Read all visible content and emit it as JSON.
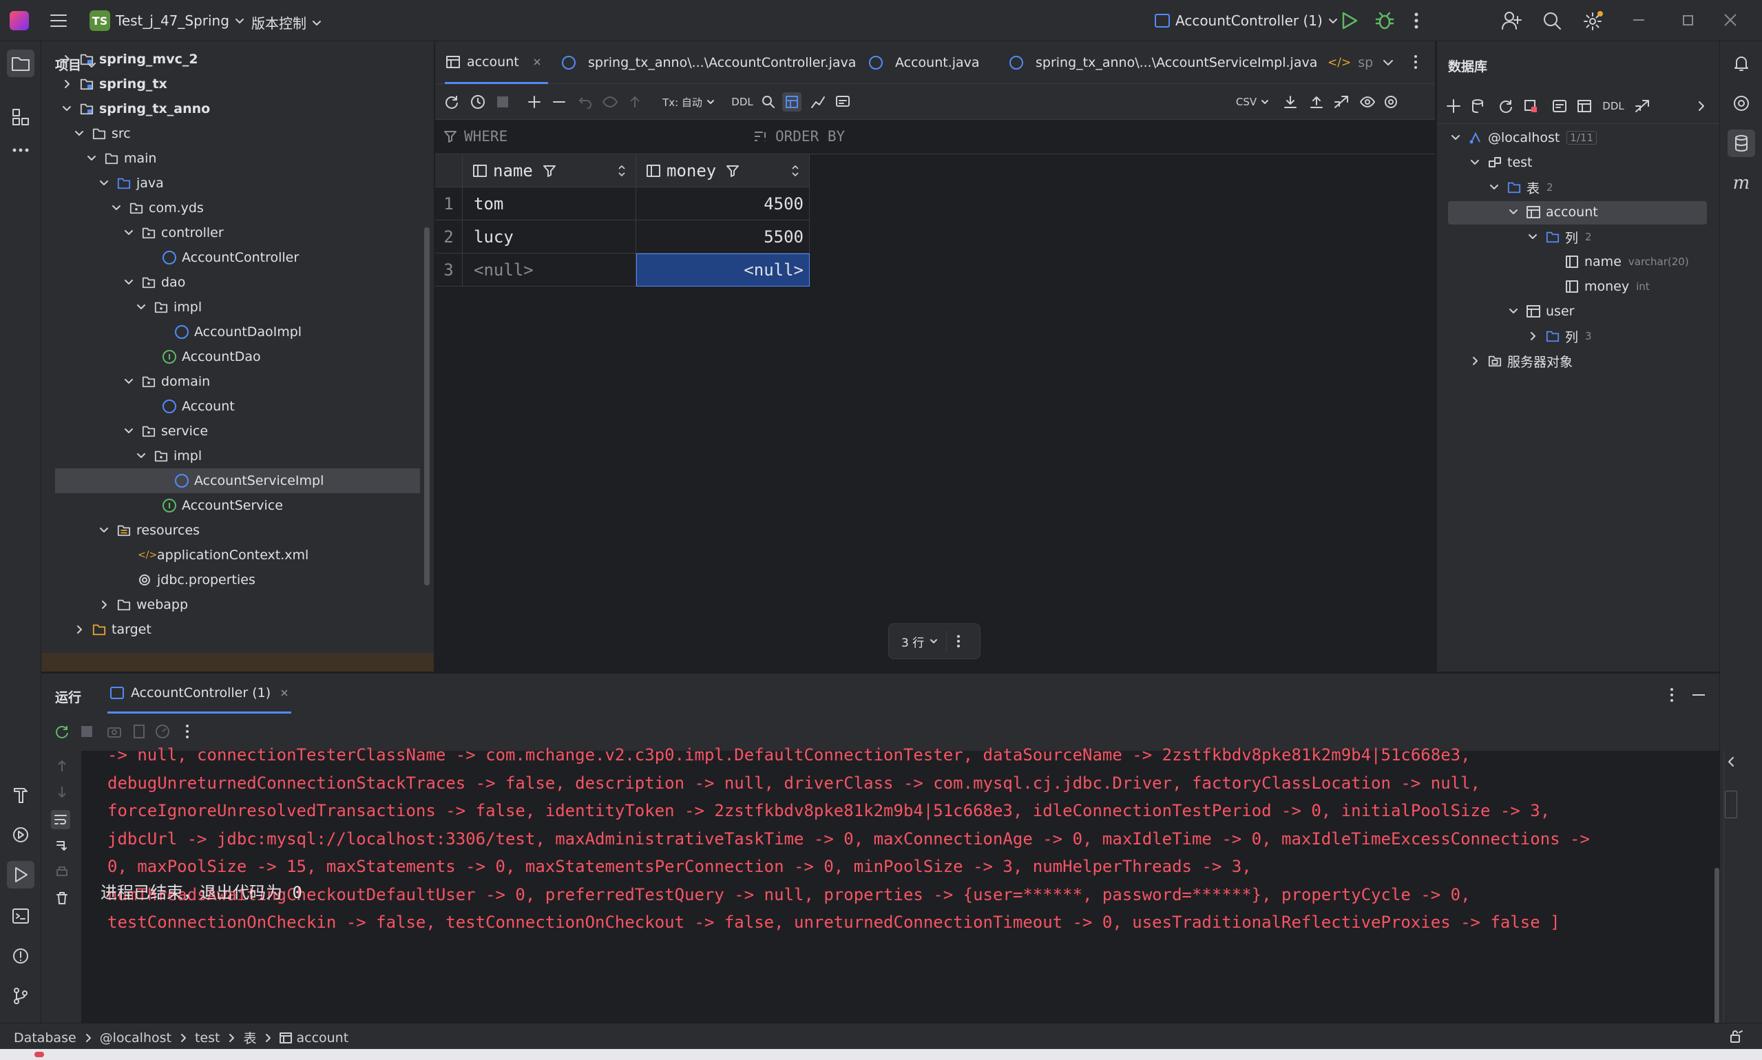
{
  "titlebar": {
    "project_badge": "TS",
    "project_name": "Test_j_47_Spring",
    "vcs": "版本控制",
    "run_config": "AccountController (1)"
  },
  "project": {
    "title": "项目",
    "items": [
      {
        "label": "spring_mvc_2"
      },
      {
        "label": "spring_tx"
      },
      {
        "label": "spring_tx_anno"
      },
      {
        "label": "src"
      },
      {
        "label": "main"
      },
      {
        "label": "java"
      },
      {
        "label": "com.yds"
      },
      {
        "label": "controller"
      },
      {
        "label": "AccountController"
      },
      {
        "label": "dao"
      },
      {
        "label": "impl"
      },
      {
        "label": "AccountDaoImpl"
      },
      {
        "label": "AccountDao"
      },
      {
        "label": "domain"
      },
      {
        "label": "Account"
      },
      {
        "label": "service"
      },
      {
        "label": "impl"
      },
      {
        "label": "AccountServiceImpl"
      },
      {
        "label": "AccountService"
      },
      {
        "label": "resources"
      },
      {
        "label": "applicationContext.xml"
      },
      {
        "label": "jdbc.properties"
      },
      {
        "label": "webapp"
      },
      {
        "label": "target"
      }
    ]
  },
  "editor": {
    "tabs": [
      {
        "label": "account"
      },
      {
        "label": "spring_tx_anno\\...\\AccountController.java"
      },
      {
        "label": "Account.java"
      },
      {
        "label": "spring_tx_anno\\...\\AccountServiceImpl.java"
      },
      {
        "label": "sp"
      }
    ],
    "toolbar": {
      "tx": "Tx: 自动",
      "ddl": "DDL",
      "export_format": "CSV"
    },
    "filter": {
      "where": "WHERE",
      "order_by": "ORDER BY"
    },
    "grid": {
      "columns": [
        "name",
        "money"
      ],
      "rows": [
        {
          "num": "1",
          "name": "tom",
          "money": "4500"
        },
        {
          "num": "2",
          "name": "lucy",
          "money": "5500"
        },
        {
          "num": "3",
          "name": "<null>",
          "money": "<null>"
        }
      ]
    },
    "row_count": "3 行"
  },
  "database": {
    "title": "数据库",
    "ddl": "DDL",
    "host": "@localhost",
    "host_count": "1/11",
    "schema": "test",
    "tables_folder": "表",
    "tables_count": "2",
    "table_account": "account",
    "columns_folder": "列",
    "columns_count": "2",
    "col_name": "name",
    "col_name_type": "varchar(20)",
    "col_money": "money",
    "col_money_type": "int",
    "table_user": "user",
    "user_columns_folder": "列",
    "user_columns_count": "3",
    "server_objects": "服务器对象"
  },
  "run": {
    "title": "运行",
    "tab": "AccountController (1)",
    "console_lines": [
      "-> null, connectionTesterClassName -> com.mchange.v2.c3p0.impl.DefaultConnectionTester, dataSourceName -> 2zstfkbdv8pke81k2m9b4|51c668e3,",
      "debugUnreturnedConnectionStackTraces -> false, description -> null, driverClass -> com.mysql.cj.jdbc.Driver, factoryClassLocation -> null,",
      "forceIgnoreUnresolvedTransactions -> false, identityToken -> 2zstfkbdv8pke81k2m9b4|51c668e3, idleConnectionTestPeriod -> 0, initialPoolSize -> 3,",
      "jdbcUrl -> jdbc:mysql://localhost:3306/test, maxAdministrativeTaskTime -> 0, maxConnectionAge -> 0, maxIdleTime -> 0, maxIdleTimeExcessConnections ->",
      "0, maxPoolSize -> 15, maxStatements -> 0, maxStatementsPerConnection -> 0, minPoolSize -> 3, numHelperThreads -> 3,",
      "numThreadsAwaitingCheckoutDefaultUser -> 0, preferredTestQuery -> null, properties -> {user=******, password=******}, propertyCycle -> 0,",
      "testConnectionOnCheckin -> false, testConnectionOnCheckout -> false, unreturnedConnectionTimeout -> 0, usesTraditionalReflectiveProxies -> false ]"
    ],
    "exit_message": "进程已结束，退出代码为 0"
  },
  "statusbar": {
    "crumbs": [
      "Database",
      "@localhost",
      "test",
      "表",
      "account"
    ]
  }
}
